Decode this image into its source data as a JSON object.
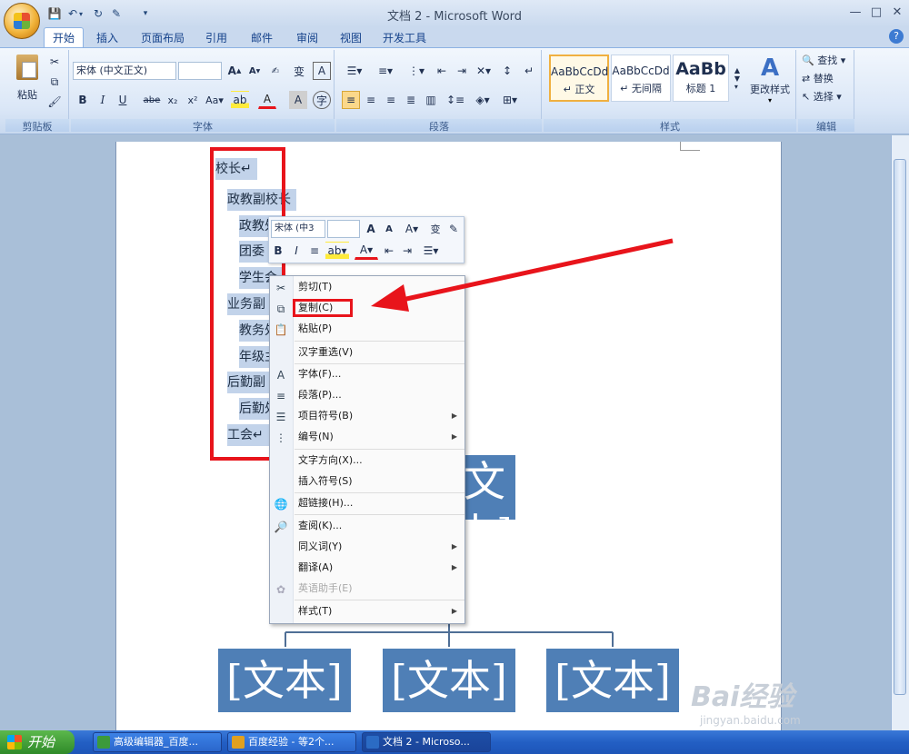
{
  "window": {
    "title": "文档 2 - Microsoft Word",
    "minimize": "—",
    "maximize": "□",
    "close": "✕",
    "help": "?"
  },
  "tabs": [
    "开始",
    "插入",
    "页面布局",
    "引用",
    "邮件",
    "审阅",
    "视图",
    "开发工具"
  ],
  "ribbon": {
    "clipboard": {
      "label": "剪贴板",
      "paste": "粘贴"
    },
    "font": {
      "label": "字体",
      "name": "宋体 (中文正文)",
      "size": ""
    },
    "paragraph": {
      "label": "段落"
    },
    "styles": {
      "label": "样式",
      "tiles": [
        {
          "preview": "AaBbCcDd",
          "name": "↵ 正文"
        },
        {
          "preview": "AaBbCcDd",
          "name": "↵ 无间隔"
        },
        {
          "preview": "AaBb",
          "name": "标题 1"
        }
      ],
      "change": "更改样式"
    },
    "editing": {
      "label": "编辑",
      "find": "查找",
      "replace": "替换",
      "select": "选择"
    }
  },
  "document": {
    "outline": [
      {
        "text": "校长↵",
        "level": 0
      },
      {
        "text": "政教副校长",
        "level": 1
      },
      {
        "text": "政教处",
        "level": 2
      },
      {
        "text": "团委",
        "level": 2
      },
      {
        "text": "学生会",
        "level": 2
      },
      {
        "text": "业务副",
        "level": 1
      },
      {
        "text": "教务处",
        "level": 2
      },
      {
        "text": "年级主",
        "level": 2
      },
      {
        "text": "后勤副",
        "level": 1
      },
      {
        "text": "后勤处",
        "level": 2
      },
      {
        "text": "工会↵",
        "level": 1
      }
    ],
    "smartart_box": "[文本]"
  },
  "mini_toolbar": {
    "font": "宋体 (中3",
    "size": ""
  },
  "context_menu": [
    {
      "label": "剪切(T)",
      "icon": "scissors-icon",
      "sub": false,
      "disabled": false
    },
    {
      "label": "复制(C)",
      "icon": "copy-icon",
      "sub": false,
      "disabled": false
    },
    {
      "label": "粘贴(P)",
      "icon": "paste-icon",
      "sub": false,
      "disabled": false
    },
    {
      "label": "汉字重选(V)",
      "icon": "",
      "sub": false,
      "disabled": false
    },
    {
      "label": "字体(F)...",
      "icon": "font-icon",
      "sub": false,
      "disabled": false
    },
    {
      "label": "段落(P)...",
      "icon": "paragraph-icon",
      "sub": false,
      "disabled": false
    },
    {
      "label": "项目符号(B)",
      "icon": "bullets-icon",
      "sub": true,
      "disabled": false
    },
    {
      "label": "编号(N)",
      "icon": "numbering-icon",
      "sub": true,
      "disabled": false
    },
    {
      "label": "文字方向(X)...",
      "icon": "",
      "sub": false,
      "disabled": false
    },
    {
      "label": "插入符号(S)",
      "icon": "",
      "sub": false,
      "disabled": false
    },
    {
      "label": "超链接(H)...",
      "icon": "hyperlink-icon",
      "sub": false,
      "disabled": false
    },
    {
      "label": "查阅(K)...",
      "icon": "research-icon",
      "sub": false,
      "disabled": false
    },
    {
      "label": "同义词(Y)",
      "icon": "",
      "sub": true,
      "disabled": false
    },
    {
      "label": "翻译(A)",
      "icon": "",
      "sub": true,
      "disabled": false
    },
    {
      "label": "英语助手(E)",
      "icon": "assistant-icon",
      "sub": false,
      "disabled": true
    },
    {
      "label": "样式(T)",
      "icon": "",
      "sub": true,
      "disabled": false
    }
  ],
  "taskbar": {
    "start": "开始",
    "items": [
      {
        "label": "高级编辑器_百度...",
        "color": "#3c9a3c"
      },
      {
        "label": "百度经验 - 等2个...",
        "color": "#e0a020"
      },
      {
        "label": "文档 2 - Microso...",
        "color": "#2b6bc4"
      }
    ]
  },
  "watermark": {
    "brand": "Bai经验",
    "url": "jingyan.baidu.com"
  },
  "colors": {
    "highlight": "#e8141b",
    "smartart": "#4f7fb6",
    "selection": "#c2d3ea"
  }
}
